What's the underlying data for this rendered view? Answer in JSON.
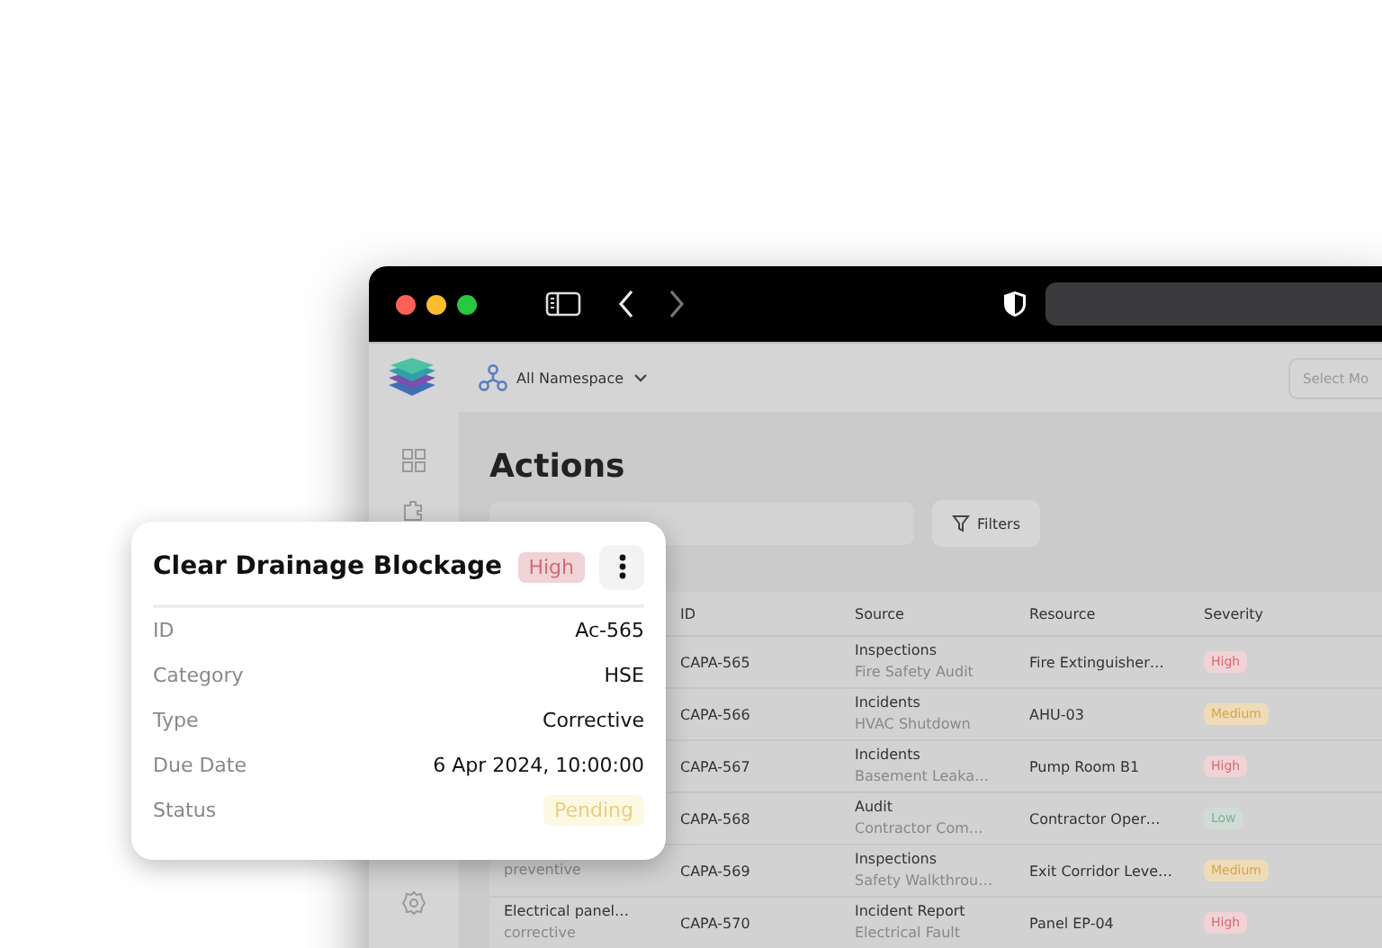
{
  "app": {
    "namespace": "All Namespace",
    "model_select": {
      "placeholder": "Select Mo"
    }
  },
  "page": {
    "title": "Actions",
    "filters_button": "Filters"
  },
  "table": {
    "columns": [
      "ID",
      "Source",
      "Resource",
      "Severity"
    ],
    "rows": [
      {
        "id": "CAPA-565",
        "source": "Inspections",
        "source_detail": "Fire Safety Audit",
        "resource": "Fire Extinguisher…",
        "severity": {
          "label": "High",
          "kind": "high"
        }
      },
      {
        "id": "CAPA-566",
        "source": "Incidents",
        "source_detail": "HVAC Shutdown",
        "resource": "AHU-03",
        "severity": {
          "label": "Medium",
          "kind": "medium"
        }
      },
      {
        "id": "CAPA-567",
        "source": "Incidents",
        "source_detail": "Basement Leaka…",
        "resource": "Pump Room B1",
        "severity": {
          "label": "High",
          "kind": "high"
        }
      },
      {
        "id": "CAPA-568",
        "source": "Audit",
        "source_detail": "Contractor Com…",
        "resource": "Contractor Oper…",
        "severity": {
          "label": "Low",
          "kind": "low"
        }
      },
      {
        "subtitle": "preventive",
        "id": "CAPA-569",
        "source": "Inspections",
        "source_detail": "Safety Walkthrou…",
        "resource": "Exit Corridor Leve…",
        "severity": {
          "label": "Medium",
          "kind": "medium"
        }
      },
      {
        "title": "Electrical panel…",
        "subtitle": "corrective",
        "id": "CAPA-570",
        "source": "Incident Report",
        "source_detail": "Electrical Fault",
        "resource": "Panel EP-04",
        "severity": {
          "label": "High",
          "kind": "high"
        }
      }
    ]
  },
  "detail_card": {
    "title": "Clear Drainage Blockage",
    "priority": {
      "label": "High",
      "kind": "high"
    },
    "fields": [
      {
        "label": "ID",
        "value": "Ac-565",
        "kind": "text"
      },
      {
        "label": "Category",
        "value": "HSE",
        "kind": "text"
      },
      {
        "label": "Type",
        "value": "Corrective",
        "kind": "text"
      },
      {
        "label": "Due Date",
        "value": "6 Apr 2024, 10:00:00",
        "kind": "text"
      },
      {
        "label": "Status",
        "value": "Pending",
        "kind": "pending"
      }
    ]
  }
}
